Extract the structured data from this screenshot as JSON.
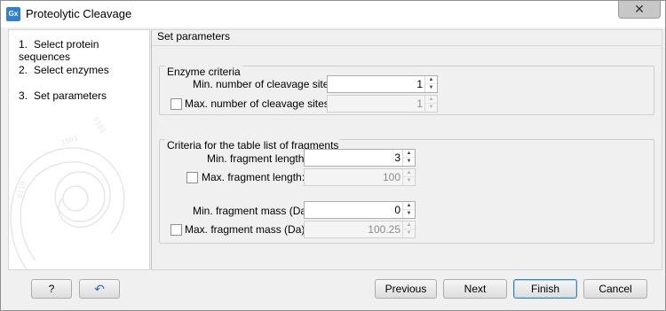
{
  "window": {
    "icon_text": "Gx",
    "title": "Proteolytic Cleavage",
    "close_symbol": "✕"
  },
  "sidebar": {
    "steps": [
      {
        "num": "1.",
        "label": "Select protein sequences"
      },
      {
        "num": "2.",
        "label": "Select enzymes"
      },
      {
        "num": "3.",
        "label": "Set parameters"
      }
    ]
  },
  "main": {
    "title": "Set parameters",
    "enzyme_criteria": {
      "title": "Enzyme criteria",
      "min_sites_label": "Min. number of cleavage sites:",
      "min_sites_value": "1",
      "max_sites_label": "Max. number of cleavage sites:",
      "max_sites_value": "1",
      "max_sites_checked": false
    },
    "fragment_criteria": {
      "title": "Criteria for the table list of fragments",
      "min_length_label": "Min. fragment length:",
      "min_length_value": "3",
      "max_length_label": "Max. fragment length:",
      "max_length_value": "100",
      "max_length_checked": false,
      "min_mass_label": "Min. fragment mass (Da):",
      "min_mass_value": "0",
      "max_mass_label": "Max. fragment mass (Da):",
      "max_mass_value": "100.25",
      "max_mass_checked": false
    }
  },
  "footer": {
    "help_label": "?",
    "reset_icon": "↶",
    "previous_label": "Previous",
    "next_label": "Next",
    "finish_label": "Finish",
    "cancel_label": "Cancel"
  },
  "colors": {
    "accent": "#3c7fb1",
    "app_icon": "#2f7fd4"
  }
}
